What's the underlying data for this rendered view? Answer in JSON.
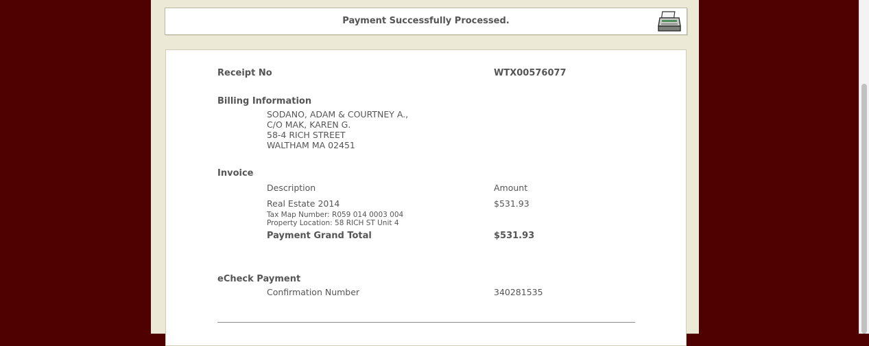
{
  "status": {
    "message": "Payment Successfully Processed."
  },
  "receipt": {
    "receipt_label": "Receipt No",
    "receipt_number": "WTX00576077",
    "billing": {
      "heading": "Billing Information",
      "lines": [
        "SODANO, ADAM & COURTNEY A.,",
        "C/O MAK, KAREN G.",
        "58-4 RICH STREET",
        "WALTHAM MA 02451"
      ]
    },
    "invoice": {
      "heading": "Invoice",
      "col_description": "Description",
      "col_amount": "Amount",
      "item_description": "Real Estate 2014",
      "item_amount": "$531.93",
      "tax_map": "Tax Map Number: R059 014 0003 004",
      "property_location": "Property Location: 58 RICH ST Unit 4",
      "grand_total_label": "Payment Grand Total",
      "grand_total_amount": "$531.93"
    },
    "payment": {
      "heading": "eCheck Payment",
      "confirmation_label": "Confirmation Number",
      "confirmation_number": "340281535"
    }
  },
  "icons": {
    "print": "printer-icon"
  },
  "colors": {
    "page_bg": "#4f0000",
    "content_bg": "#ecead6",
    "text": "#555555"
  }
}
